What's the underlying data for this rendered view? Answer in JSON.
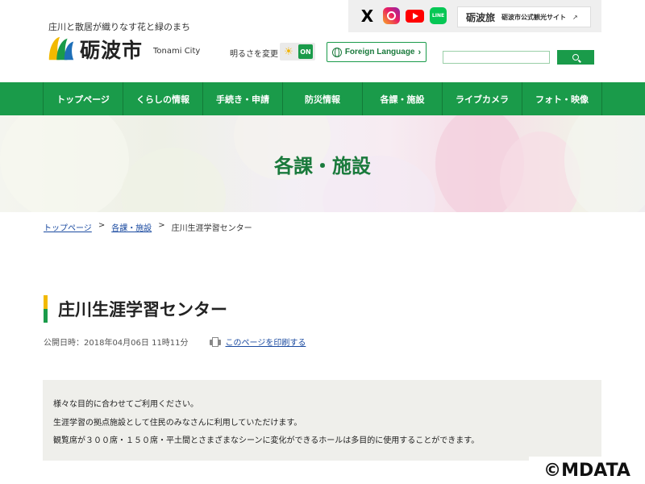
{
  "header": {
    "tagline": "庄川と散居が織りなす花と緑のまち",
    "logo_text": "砺波市",
    "logo_en": "Tonami City",
    "brightness_label": "明るさを変更",
    "brightness_state": "ON",
    "language_button": "Foreign Language",
    "tourism_logo": "砺波旅",
    "tourism_text": "砺波市公式観光サイト",
    "search_placeholder": "",
    "search_value": ""
  },
  "social": {
    "x": "X",
    "line": "LINE"
  },
  "nav": {
    "items": [
      "トップページ",
      "くらしの情報",
      "手続き・申請",
      "防災情報",
      "各課・施設",
      "ライブカメラ",
      "フォト・映像"
    ]
  },
  "hero": {
    "title": "各課・施設"
  },
  "breadcrumb": {
    "items": [
      "トップページ",
      "各課・施設",
      "庄川生涯学習センター"
    ],
    "separator": ">"
  },
  "page": {
    "title": "庄川生涯学習センター",
    "published": "公開日時：2018年04月06日 11時11分",
    "print_label": "このページを印刷する"
  },
  "intro": {
    "lines": [
      "様々な目的に合わせてご利用ください。",
      "生涯学習の拠点施設として住民のみなさんに利用していただけます。",
      "観覧席が３００席・１５０席・平土間とさまざまなシーンに変化ができるホールは多目的に使用することができます。"
    ]
  },
  "watermark": "©MDATA",
  "colors": {
    "brand_green": "#1a9b4a",
    "accent_yellow": "#f2b900",
    "link_blue": "#1a4aa0"
  }
}
